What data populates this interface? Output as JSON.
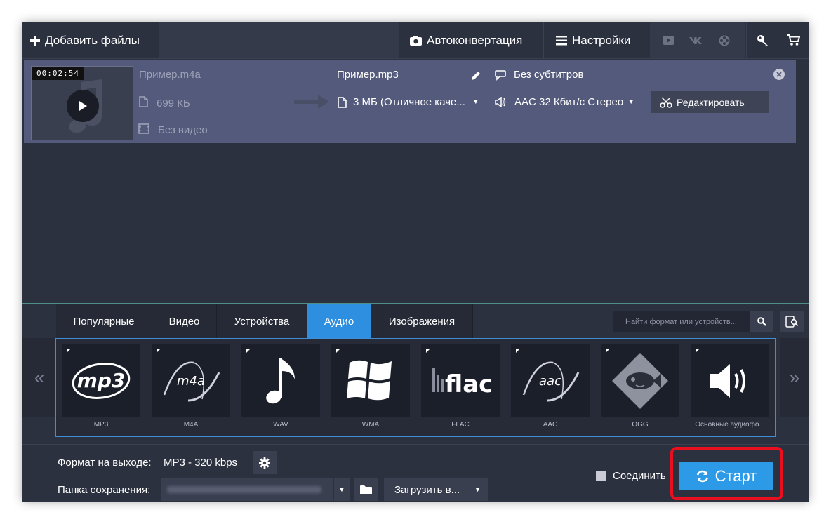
{
  "toolbar": {
    "add_files": "Добавить файлы",
    "autoconvert": "Автоконвертация",
    "settings": "Настройки",
    "icons": [
      "youtube-icon",
      "vk-icon",
      "film-reel-icon",
      "key-icon",
      "cart-icon"
    ]
  },
  "file": {
    "duration": "00:02:54",
    "source_name": "Пример.m4a",
    "source_size": "699 КБ",
    "source_video": "Без видео",
    "output_name": "Пример.mp3",
    "output_size": "3 МБ (Отличное каче...",
    "subtitles": "Без субтитров",
    "audio": "AAC 32 Кбит/с Стерео",
    "edit_label": "Редактировать"
  },
  "tabs": [
    {
      "label": "Популярные",
      "active": false
    },
    {
      "label": "Видео",
      "active": false
    },
    {
      "label": "Устройства",
      "active": false
    },
    {
      "label": "Аудио",
      "active": true
    },
    {
      "label": "Изображения",
      "active": false
    }
  ],
  "search": {
    "placeholder": "Найти формат или устройств..."
  },
  "nav": {
    "prev": "«",
    "next": "»"
  },
  "formats": [
    {
      "label": "MP3",
      "logo": "mp3"
    },
    {
      "label": "M4A",
      "logo": "m4a"
    },
    {
      "label": "WAV",
      "logo": "♪"
    },
    {
      "label": "WMA",
      "logo": "windows"
    },
    {
      "label": "FLAC",
      "logo": "flac"
    },
    {
      "label": "AAC",
      "logo": "aac"
    },
    {
      "label": "OGG",
      "logo": "ogg-fish"
    },
    {
      "label": "Основные аудиофо...",
      "logo": "speaker"
    }
  ],
  "bottom": {
    "format_label": "Формат на выходе:",
    "format_value": "MP3 - 320 kbps",
    "folder_label": "Папка сохранения:",
    "upload_label": "Загрузить в...",
    "join_label": "Соединить",
    "start_label": "Старт"
  },
  "colors": {
    "accent": "#2e8fe0",
    "file_row": "#545a7b",
    "background": "#2c3140",
    "highlight": "#e8101e"
  }
}
